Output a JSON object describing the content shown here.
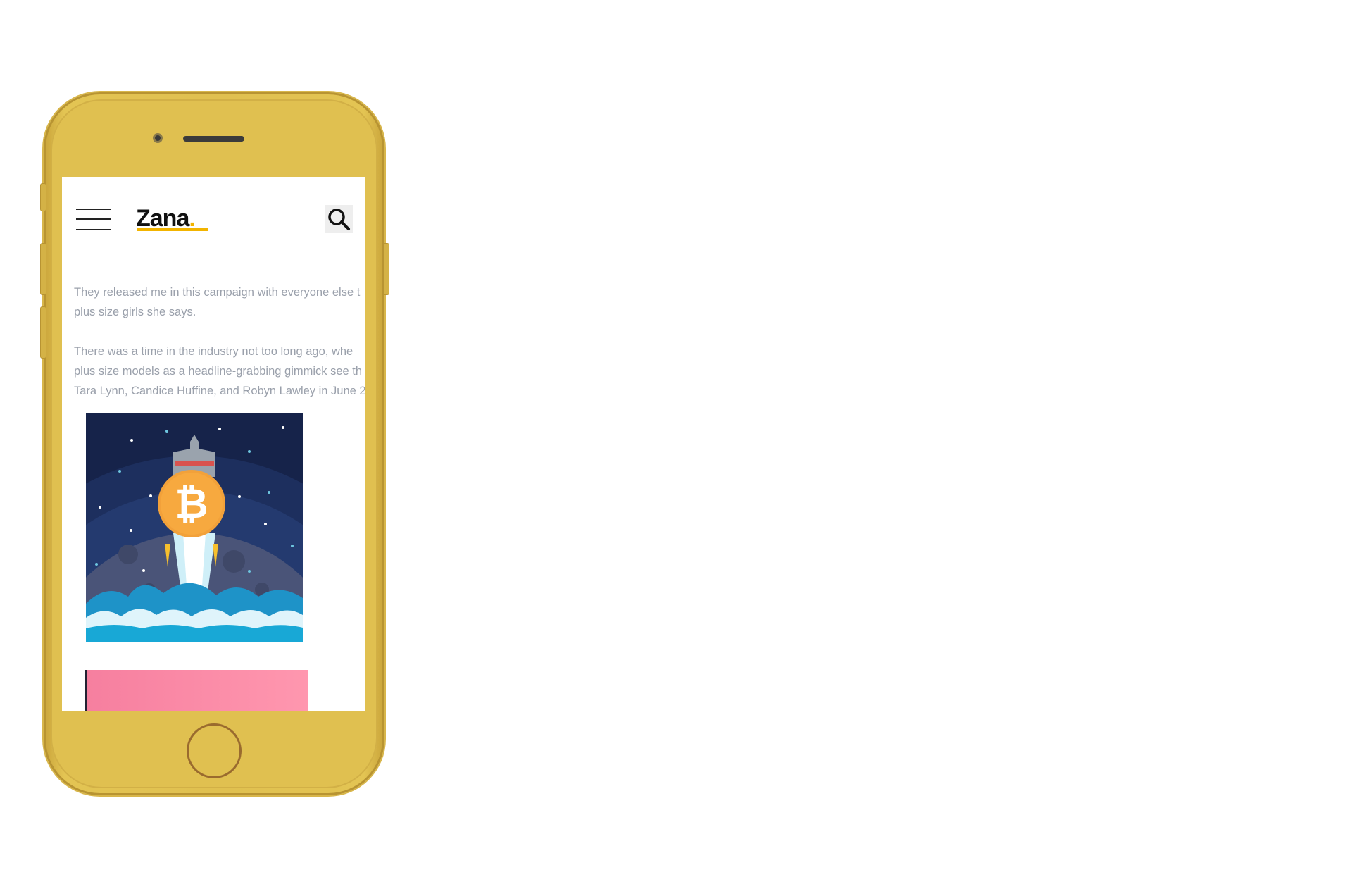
{
  "site": {
    "logo_text": "Zana",
    "logo_dot": ".",
    "accent_color": "#f2b400",
    "phone_color": "#e0c050"
  },
  "header": {
    "menu_icon": "hamburger-menu-icon",
    "search_icon": "search-icon"
  },
  "article": {
    "paragraphs": [
      {
        "lines": [
          "They released me in this campaign with everyone else t",
          "plus size girls she says."
        ]
      },
      {
        "lines": [
          "There was a time in the industry not too long ago, whe",
          "plus size models as a headline-grabbing gimmick see th",
          "Tara Lynn, Candice Huffine, and Robyn Lawley in June 2"
        ]
      }
    ]
  },
  "images": [
    {
      "name": "bitcoin-rocket-image",
      "icon": "bitcoin-symbol",
      "symbol": "₿"
    },
    {
      "name": "pink-promo-image"
    }
  ]
}
